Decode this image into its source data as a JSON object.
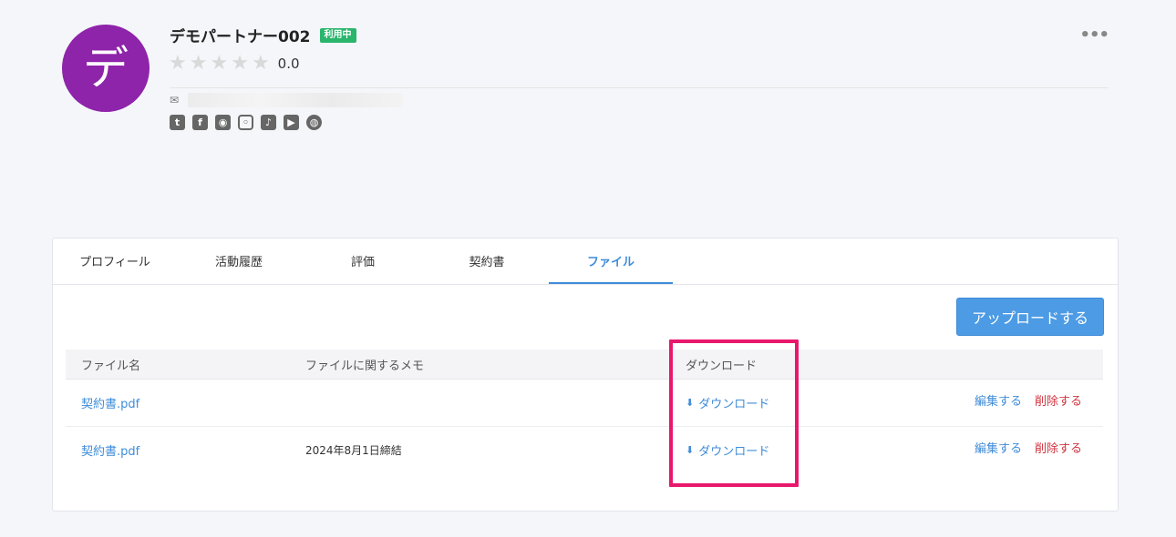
{
  "profile": {
    "avatar_char": "デ",
    "name": "デモパートナー002",
    "status_badge": "利用中",
    "rating_value": "0.0",
    "stars": 5,
    "colors": {
      "avatar": "#8e24aa",
      "badge": "#2ab56c"
    }
  },
  "social": [
    "twitter-icon",
    "facebook-icon",
    "github-icon",
    "instagram-icon",
    "tiktok-icon",
    "youtube-icon",
    "website-icon"
  ],
  "tabs": [
    {
      "label": "プロフィール",
      "active": false
    },
    {
      "label": "活動履歴",
      "active": false
    },
    {
      "label": "評価",
      "active": false
    },
    {
      "label": "契約書",
      "active": false
    },
    {
      "label": "ファイル",
      "active": true
    }
  ],
  "upload_button": "アップロードする",
  "table": {
    "headers": {
      "file_name": "ファイル名",
      "memo": "ファイルに関するメモ",
      "download": "ダウンロード"
    },
    "rows": [
      {
        "file_name": "契約書.pdf",
        "memo": "",
        "download": "ダウンロード",
        "edit": "編集する",
        "delete": "削除する"
      },
      {
        "file_name": "契約書.pdf",
        "memo": "2024年8月1日締結",
        "download": "ダウンロード",
        "edit": "編集する",
        "delete": "削除する"
      }
    ]
  },
  "accent_color": "#3f8cd9",
  "highlight_color": "#e8186d"
}
